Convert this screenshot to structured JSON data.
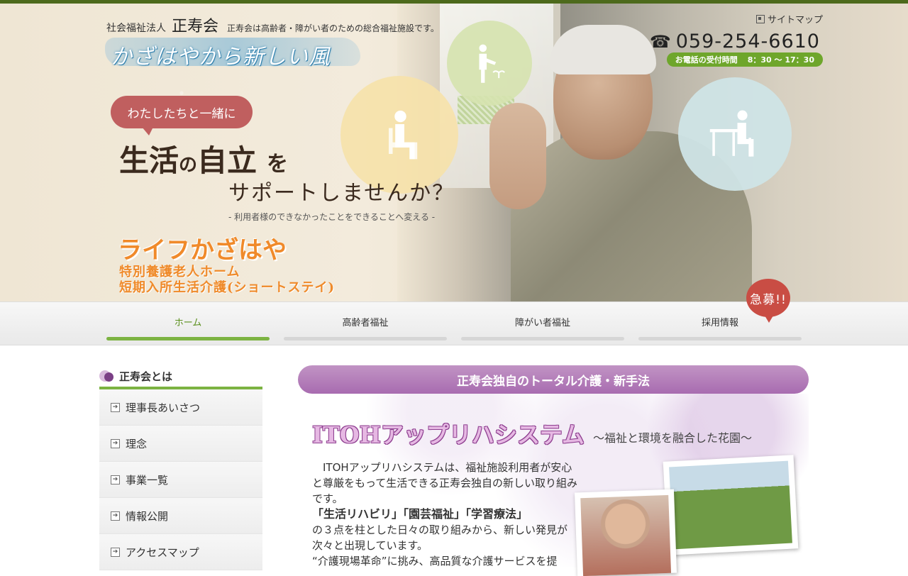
{
  "colors": {
    "accent_green": "#7cb342",
    "nav_active": "#5a8f1c",
    "purple": "#a86cb0",
    "recruit_red": "#c94d44",
    "facility_orange": "#f08a2a"
  },
  "header": {
    "org_prefix": "社会福祉法人",
    "org_name": "正寿会",
    "org_desc": "正寿会は高齢者・障がい者のための総合福祉施設です。",
    "catchphrase": "かざはやから新しい風",
    "sitemap": "サイトマップ",
    "phone": "059-254-6610",
    "hours_label": "お電話の受付時間",
    "hours_value": "8：30 〜 17：30"
  },
  "hero": {
    "bubble": "わたしたちと一緒に",
    "headline_1": "生活",
    "headline_no": "の",
    "headline_2": "自立",
    "headline_wo": "を",
    "headline_line2": "サポートしませんか？",
    "subnote": "- 利用者様のできなかったことをできることへ変える -",
    "facility_name": "ライフかざはや",
    "facility_sub1": "特別養護老人ホーム",
    "facility_sub2": "短期入所生活介護(ショートステイ)",
    "icons": [
      "person-sitting-icon",
      "person-watering-icon",
      "person-at-desk-icon"
    ]
  },
  "nav": {
    "items": [
      {
        "label": "ホーム",
        "active": true
      },
      {
        "label": "高齢者福祉"
      },
      {
        "label": "障がい者福祉"
      },
      {
        "label": "採用情報"
      }
    ],
    "recruit_badge": "急募!!"
  },
  "sidebar": {
    "title": "正寿会とは",
    "items": [
      {
        "label": "理事長あいさつ"
      },
      {
        "label": "理念"
      },
      {
        "label": "事業一覧"
      },
      {
        "label": "情報公開"
      },
      {
        "label": "アクセスマップ"
      }
    ]
  },
  "main": {
    "section_title": "正寿会独自のトータル介護・新手法",
    "system_title": "ITOHアップリハシステム",
    "system_subtitle": "〜福祉と環境を融合した花園〜",
    "para1": "ITOHアップリハシステムは、福祉施設利用者が安心と尊厳をもって生活できる正寿会独自の新しい取り組みです。",
    "pillars": "「生活リハビリ」「園芸福祉」「学習療法」",
    "para2": "の３点を柱とした日々の取り組みから、新しい発見が次々と出現しています。",
    "para3": "“介護現場革命”に挑み、高品質な介護サービスを提"
  }
}
